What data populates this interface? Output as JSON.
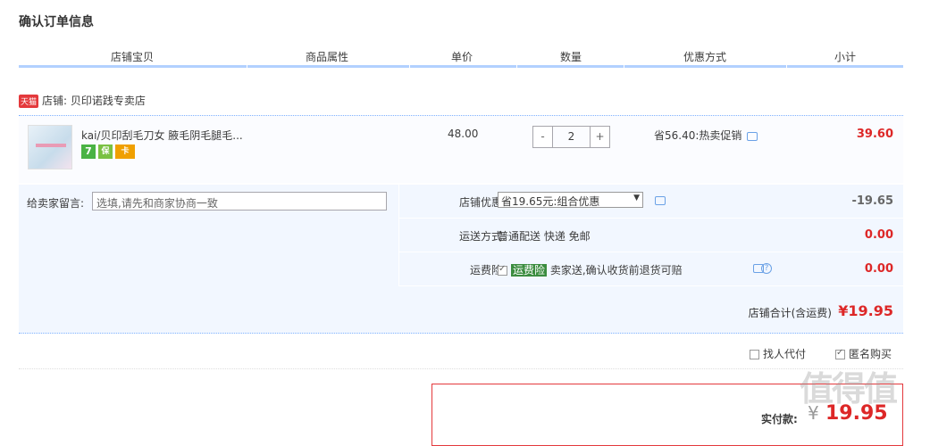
{
  "page_title": "确认订单信息",
  "columns": [
    "店铺宝贝",
    "商品属性",
    "单价",
    "数量",
    "优惠方式",
    "小计"
  ],
  "shop": {
    "badge": "天猫",
    "label": "店铺: 贝印诺践专卖店"
  },
  "item": {
    "name": "kai/贝印刮毛刀女 腋毛阴毛腿毛...",
    "badges": [
      "7",
      "保",
      "卡"
    ],
    "price": "48.00",
    "qty_minus": "-",
    "qty": "2",
    "qty_plus": "+",
    "promo": "省56.40:热卖促销",
    "subtotal": "39.60"
  },
  "memo": {
    "label": "给卖家留言:",
    "placeholder": "选填,请先和商家协商一致"
  },
  "discount": {
    "label": "店铺优惠:",
    "selected": "省19.65元:组合优惠",
    "amount": "-19.65"
  },
  "shipping": {
    "label": "运送方式:",
    "value": "普通配送 快递 免邮",
    "amount": "0.00"
  },
  "insurance": {
    "label": "运费险:",
    "tag": "运费险",
    "desc": "卖家送,确认收货前退货可赔",
    "amount": "0.00"
  },
  "shop_total": {
    "label": "店铺合计(含运费)",
    "amount": "¥19.95"
  },
  "agents": {
    "proxy": "找人代付",
    "anonymous": "匿名购买"
  },
  "pay": {
    "label": "实付款:",
    "yen": "¥",
    "amount": "19.95"
  },
  "watermark": "值得值",
  "colors": {
    "accent_red": "#dd2727",
    "header_rule": "#b2d1ff",
    "row_bg": "#f2f7ff",
    "insure_green": "#3b8c3f"
  }
}
